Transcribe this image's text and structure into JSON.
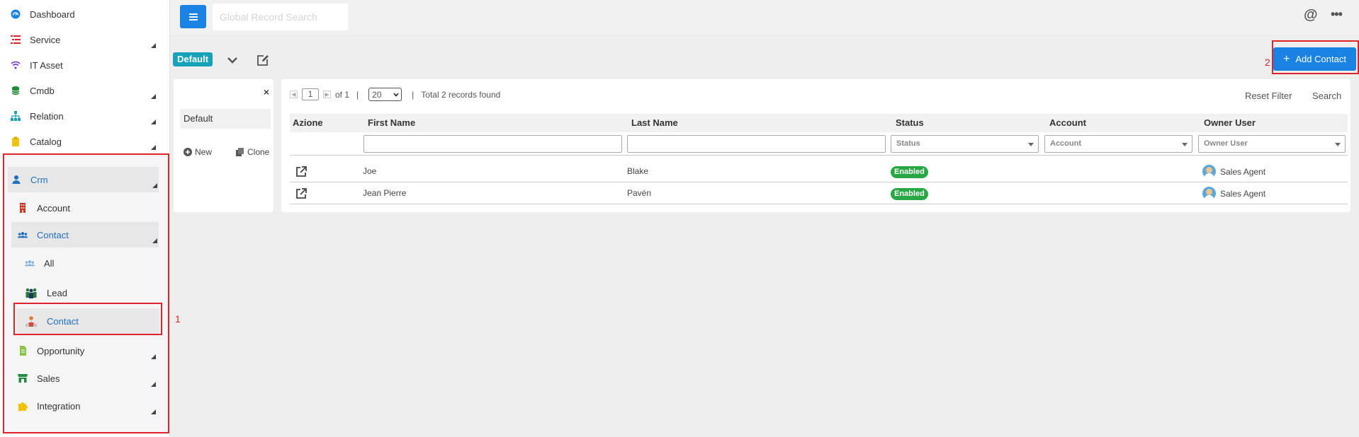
{
  "sidebar": {
    "items": [
      {
        "label": "Dashboard",
        "icon": "dashboard-icon"
      },
      {
        "label": "Service",
        "icon": "service-icon"
      },
      {
        "label": "IT Asset",
        "icon": "wifi-icon"
      },
      {
        "label": "Cmdb",
        "icon": "database-icon"
      },
      {
        "label": "Relation",
        "icon": "sitemap-icon"
      },
      {
        "label": "Catalog",
        "icon": "clipboard-icon"
      },
      {
        "label": "Crm",
        "icon": "user-icon"
      },
      {
        "label": "Account",
        "icon": "building-icon"
      },
      {
        "label": "Contact",
        "icon": "users-icon"
      },
      {
        "label": "All",
        "icon": "users-icon"
      },
      {
        "label": "Lead",
        "icon": "people-group-icon"
      },
      {
        "label": "Contact",
        "icon": "contact-person-icon"
      },
      {
        "label": "Opportunity",
        "icon": "document-icon"
      },
      {
        "label": "Sales",
        "icon": "store-icon"
      },
      {
        "label": "Integration",
        "icon": "puzzle-icon"
      }
    ]
  },
  "header": {
    "search_placeholder": "Global Record Search",
    "at_symbol": "@",
    "more_symbol": "•••"
  },
  "toolbar": {
    "view_name": "Default",
    "add_contact_label": "Add Contact",
    "add_symbol": "+"
  },
  "annotations": {
    "box1": "1",
    "box2": "2"
  },
  "views": {
    "close_symbol": "×",
    "default_label": "Default",
    "new_label": "New",
    "clone_label": "Clone"
  },
  "grid": {
    "page_current": "1",
    "page_of": "of 1",
    "separator": "|",
    "page_size": "20",
    "records_found": "Total 2 records found",
    "reset_filter_label": "Reset Filter",
    "search_label": "Search",
    "columns": [
      "Azione",
      "First Name",
      "Last Name",
      "Status",
      "Account",
      "Owner User"
    ],
    "filters": {
      "status_placeholder": "Status",
      "account_placeholder": "Account",
      "owner_placeholder": "Owner User"
    },
    "rows": [
      {
        "first_name": "Joe",
        "last_name": "Blake",
        "status": "Enabled",
        "account": "",
        "owner": "Sales Agent"
      },
      {
        "first_name": "Jean Pierre",
        "last_name": "Pavén",
        "status": "Enabled",
        "account": "",
        "owner": "Sales Agent"
      }
    ]
  },
  "colors": {
    "primary": "#1a82e2",
    "badge_teal": "#16a2b8",
    "status_green": "#28a745",
    "annotation_red": "#e0242b"
  }
}
